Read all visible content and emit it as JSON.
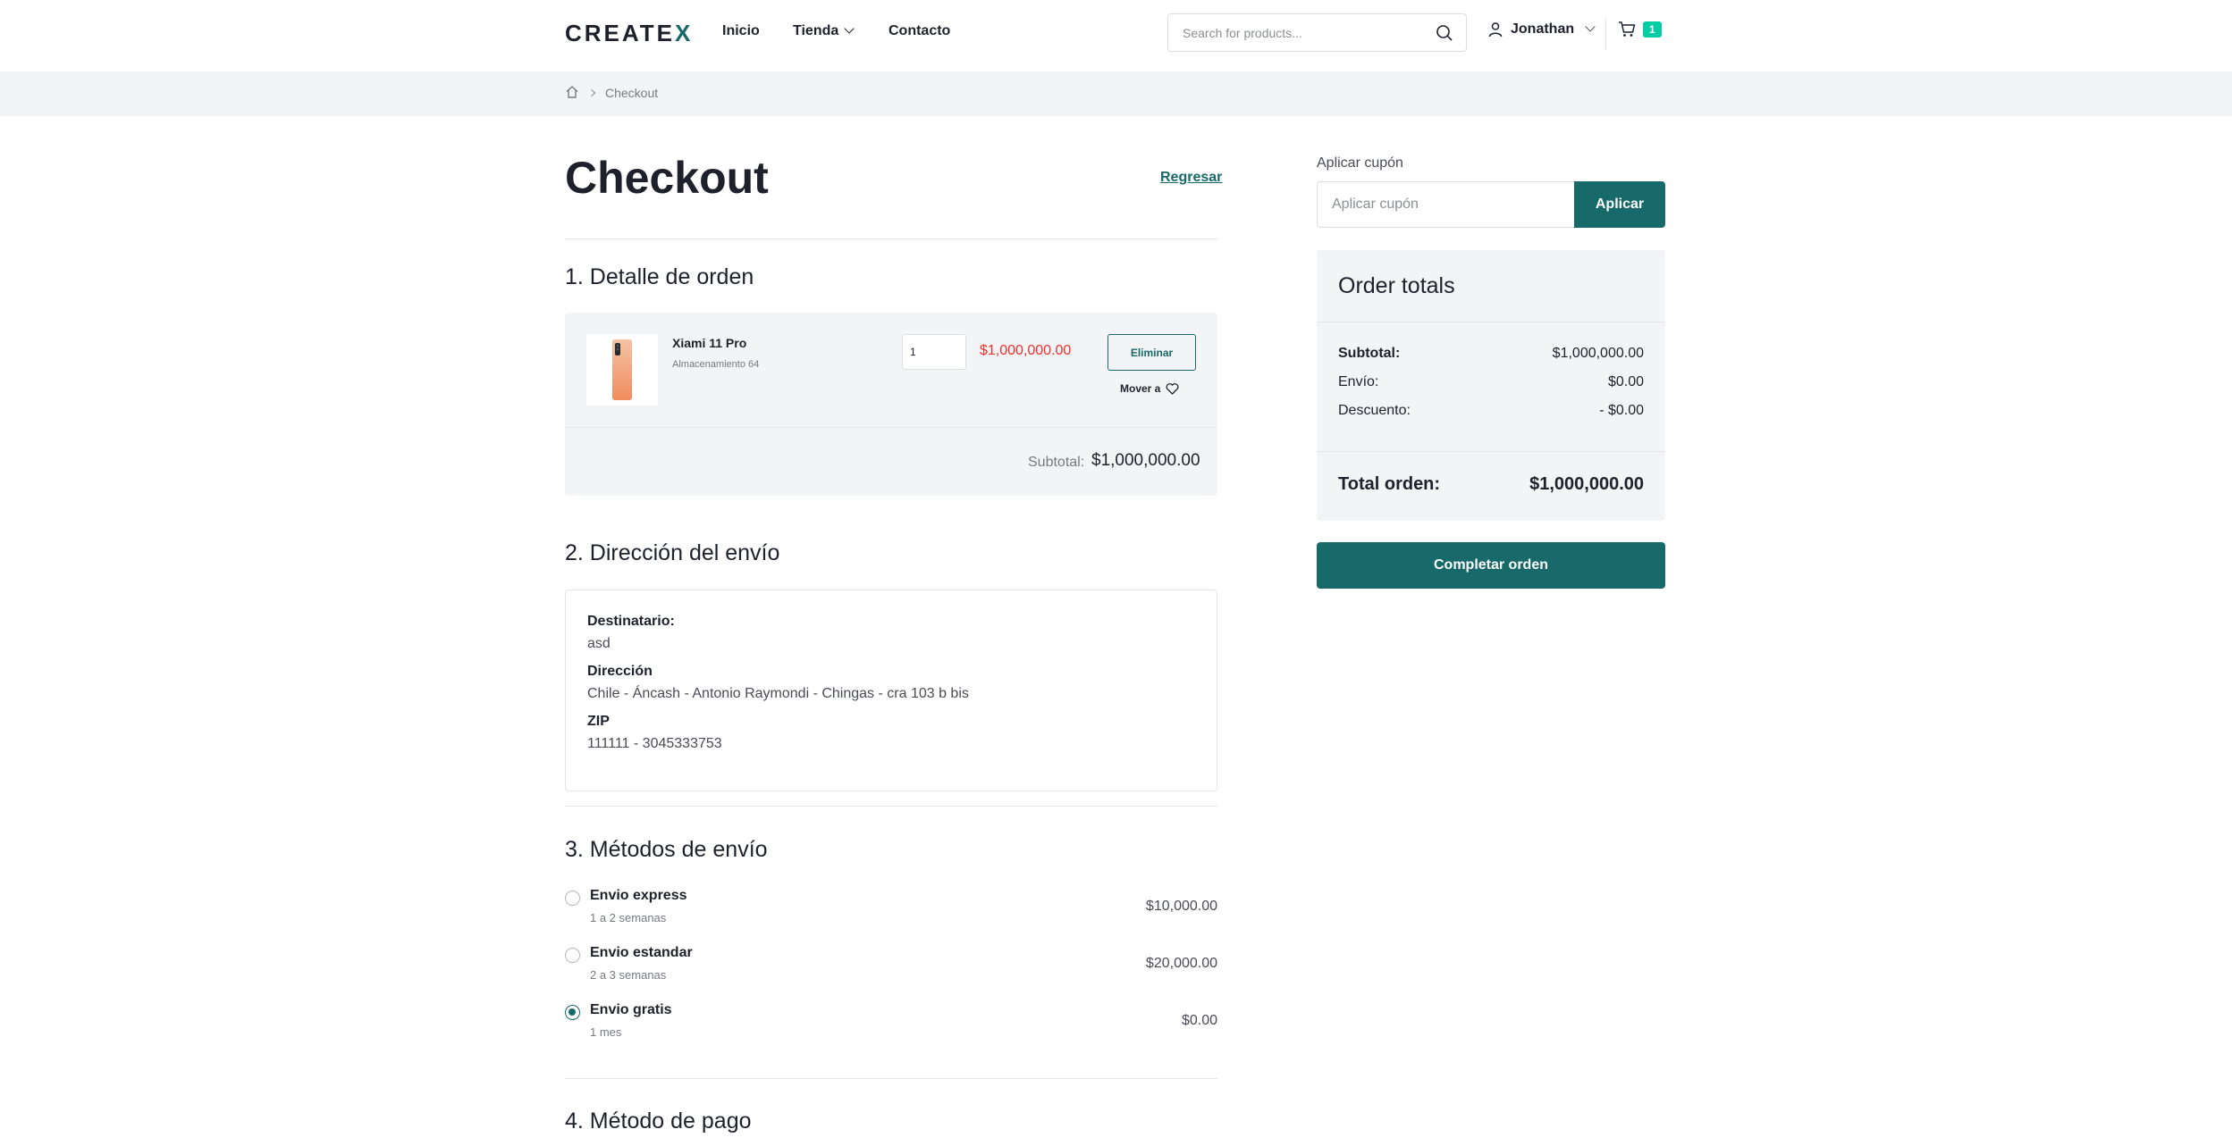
{
  "brand": {
    "logo_text": "CREATE",
    "logo_accent": "X",
    "accent_color": "#17696a"
  },
  "nav": {
    "items": [
      "Inicio",
      "Tienda",
      "Contacto"
    ]
  },
  "search": {
    "placeholder": "Search for products..."
  },
  "user": {
    "name": "Jonathan"
  },
  "cart": {
    "count": "1"
  },
  "breadcrumb": {
    "current": "Checkout"
  },
  "page": {
    "title": "Checkout",
    "back_label": "Regresar"
  },
  "order": {
    "section_title": "1. Detalle de orden",
    "item": {
      "name": "Xiami 11 Pro",
      "attribute": "Almacenamiento 64",
      "quantity": "1",
      "price": "$1,000,000.00",
      "remove_label": "Eliminar",
      "move_label": "Mover a"
    },
    "subtotal_label": "Subtotal:",
    "subtotal_value": "$1,000,000.00"
  },
  "shipping_address": {
    "section_title": "2. Dirección del envío",
    "recipient_label": "Destinatario:",
    "recipient": "asd",
    "address_label": "Dirección",
    "address": "Chile - Áncash - Antonio Raymondi - Chingas - cra 103 b bis",
    "zip_label": "ZIP",
    "zip": "111111 - 3045333753"
  },
  "shipping_methods": {
    "section_title": "3. Métodos de envío",
    "options": [
      {
        "name": "Envio express",
        "time": "1 a 2 semanas",
        "price": "$10,000.00",
        "selected": false
      },
      {
        "name": "Envio estandar",
        "time": "2 a 3 semanas",
        "price": "$20,000.00",
        "selected": false
      },
      {
        "name": "Envio gratis",
        "time": "1 mes",
        "price": "$0.00",
        "selected": true
      }
    ]
  },
  "payment": {
    "section_title": "4. Método de pago"
  },
  "coupon": {
    "label": "Aplicar cupón",
    "placeholder": "Aplicar cupón",
    "button": "Aplicar"
  },
  "totals": {
    "title": "Order totals",
    "subtotal_label": "Subtotal:",
    "subtotal": "$1,000,000.00",
    "shipping_label": "Envío:",
    "shipping": "$0.00",
    "discount_label": "Descuento:",
    "discount": "- $0.00",
    "total_label": "Total orden:",
    "total": "$1,000,000.00"
  },
  "complete_button": "Completar orden"
}
